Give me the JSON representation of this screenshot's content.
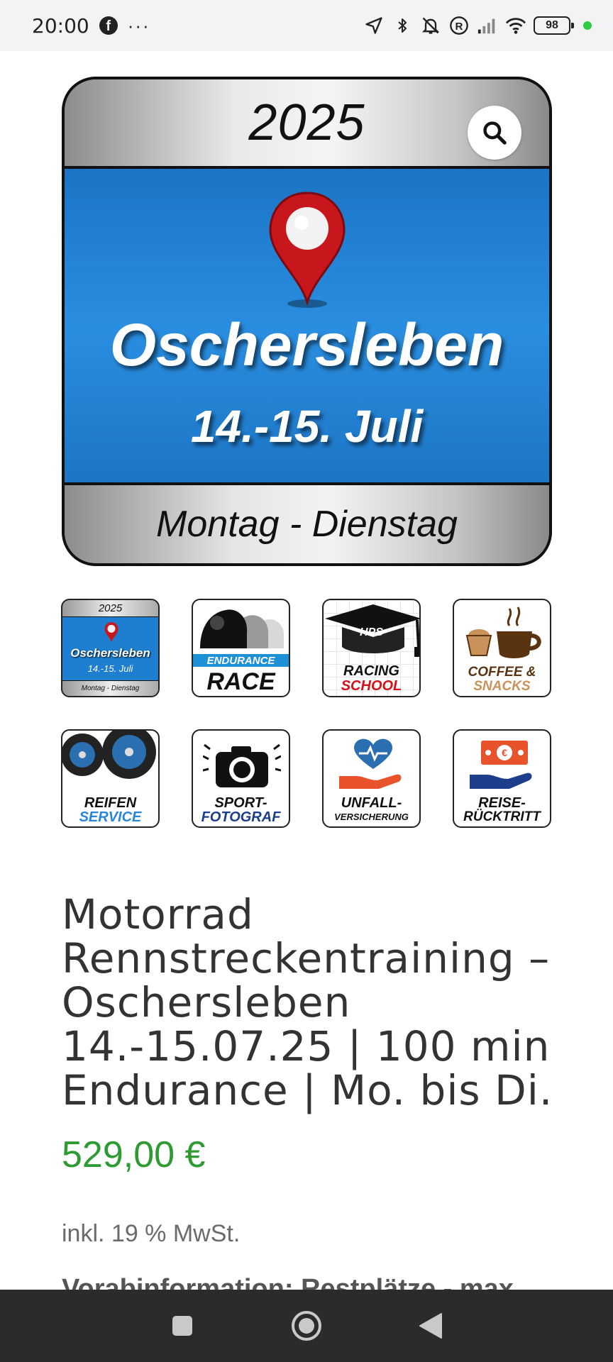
{
  "status_bar": {
    "time": "20:00",
    "facebook_icon": "f",
    "more": "···",
    "battery": "98",
    "icons": [
      "location-icon",
      "bluetooth-icon",
      "silent-icon",
      "registered-icon",
      "signal-icon",
      "wifi-icon"
    ],
    "dot_color": "#2ecc40"
  },
  "hero": {
    "year": "2025",
    "city": "Oschersleben",
    "date": "14.-15. Juli",
    "days": "Montag - Dienstag",
    "accent": "#1e7fd0"
  },
  "thumbnails": [
    {
      "name": "thumb-event",
      "year": "2025",
      "city": "Oschersleben",
      "date": "14.-15. Juli",
      "days": "Montag - Dienstag"
    },
    {
      "name": "thumb-endurance-race",
      "line1": "ENDURANCE",
      "line2": "RACE"
    },
    {
      "name": "thumb-racing-school",
      "badge": "HPS",
      "line1": "RACING",
      "line2": "SCHOOL"
    },
    {
      "name": "thumb-coffee-snacks",
      "line1": "COFFEE &",
      "line2": "SNACKS"
    },
    {
      "name": "thumb-reifen-service",
      "line1": "REIFEN",
      "line2": "SERVICE"
    },
    {
      "name": "thumb-sport-fotograf",
      "line1": "SPORT-",
      "line2": "FOTOGRAF"
    },
    {
      "name": "thumb-unfallversicherung",
      "line1": "UNFALL-",
      "line2": "VERSICHERUNG"
    },
    {
      "name": "thumb-reiseruecktritt",
      "line1": "REISE-",
      "line2": "RÜCKTRITT"
    }
  ],
  "product": {
    "title_lines": [
      "Motorrad",
      "Rennstreckentraining –",
      "Oschersleben",
      "14.-15.07.25 | 100 min",
      "Endurance | Mo. bis Di."
    ],
    "price": "529,00 €",
    "price_color": "#2e9b32",
    "tax_note": "inkl. 19 % MwSt.",
    "pre_info": "Vorabinformation: Restplätze - max"
  }
}
